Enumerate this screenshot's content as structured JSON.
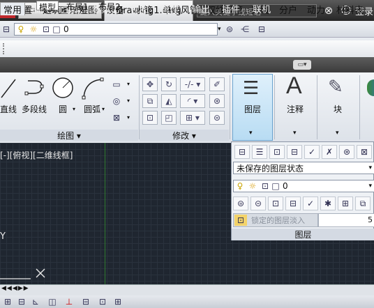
{
  "titlebar": {
    "doc_name": "Drawing1.dwg",
    "search_placeholder": "键入关键字或短语",
    "login_label": "登录"
  },
  "layerbar": {
    "layer_value": "0"
  },
  "menus": [
    "设置",
    "建筑",
    "焙湿图",
    "设备",
    "水管",
    "单线风管",
    "双线风管",
    "采暖",
    "分户",
    "动力",
    "材料表"
  ],
  "tabs": [
    "常用",
    "插入",
    "注释",
    "参数化",
    "视图",
    "管理",
    "输出",
    "插件",
    "联机"
  ],
  "ribbon": {
    "draw": {
      "line": "直线",
      "polyline": "多段线",
      "circle": "圆",
      "arc": "圆弧",
      "group": "绘图"
    },
    "modify": {
      "group": "修改"
    },
    "layers": {
      "label": "图层"
    },
    "annotate": {
      "letter": "A",
      "label": "注释"
    },
    "block": {
      "label": "块"
    }
  },
  "layer_panel": {
    "state_value": "未保存的图层状态",
    "layer_value": "0",
    "lock_fade_label": "锁定的图层淡入",
    "lock_fade_value": "5",
    "footer": "图层"
  },
  "viewport": {
    "label": "[-][俯视][二维线框]",
    "axis_y": "Y"
  },
  "layout_tabs": [
    "模型",
    "布局1",
    "布局2"
  ]
}
